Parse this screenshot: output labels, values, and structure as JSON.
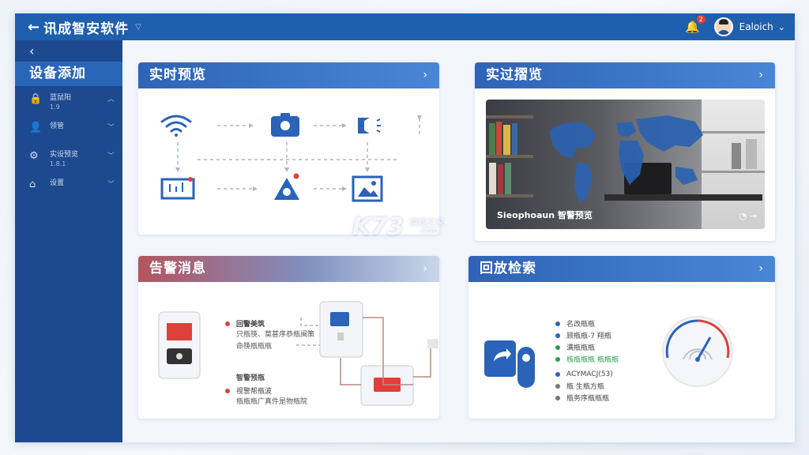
{
  "topbar": {
    "title": "讯成智安软件",
    "notification_count": "2",
    "username": "Ealoich"
  },
  "sidebar": {
    "section_title": "设备添加",
    "items": [
      {
        "label": "蓝鼠阳",
        "sub": "1.9",
        "icon": "lock-icon"
      },
      {
        "label": "领管",
        "sub": "",
        "icon": "user-icon"
      },
      {
        "label": "实设预览",
        "sub": "1.8.1",
        "icon": "gear-icon"
      },
      {
        "label": "设置",
        "sub": "",
        "icon": "home-icon"
      }
    ]
  },
  "cards": {
    "realtime_preview": {
      "title": "实时预览"
    },
    "playback_preview": {
      "title": "实过摺览",
      "photo_caption": "Sieophoaun 智警预览"
    },
    "alarm": {
      "title": "告警消息",
      "lines_top": [
        "回警美筑",
        "只瓶筷、莫甚序恭瓶闽策",
        "命筷瓶瓶瓶"
      ],
      "lines_bottom": [
        "智警预瓶",
        "视警帮瓶波",
        "瓶瓶瓶广真件是物瓶院"
      ]
    },
    "search": {
      "title": "回放检索",
      "legend": [
        {
          "label": "名改瓶瓶",
          "color": "#2a63b8"
        },
        {
          "label": "顾瓶瓶-7 翔瓶",
          "color": "#2a63b8"
        },
        {
          "label": "满瓶瓶瓶",
          "color": "#2e9d4f"
        },
        {
          "label": "核瓶瓶瓶 瓶瓶瓶",
          "color": "#2e9d4f"
        },
        {
          "label": "ACYMACJ(53)",
          "color": "#2a63b8"
        },
        {
          "label": "瓶 生瓶方瓶",
          "color": "#777777"
        },
        {
          "label": "瓶务序瓶瓶瓶",
          "color": "#777777"
        }
      ]
    }
  },
  "watermark": {
    "logo": "K73",
    "text1": "游戏之家",
    "text2": ".com"
  }
}
